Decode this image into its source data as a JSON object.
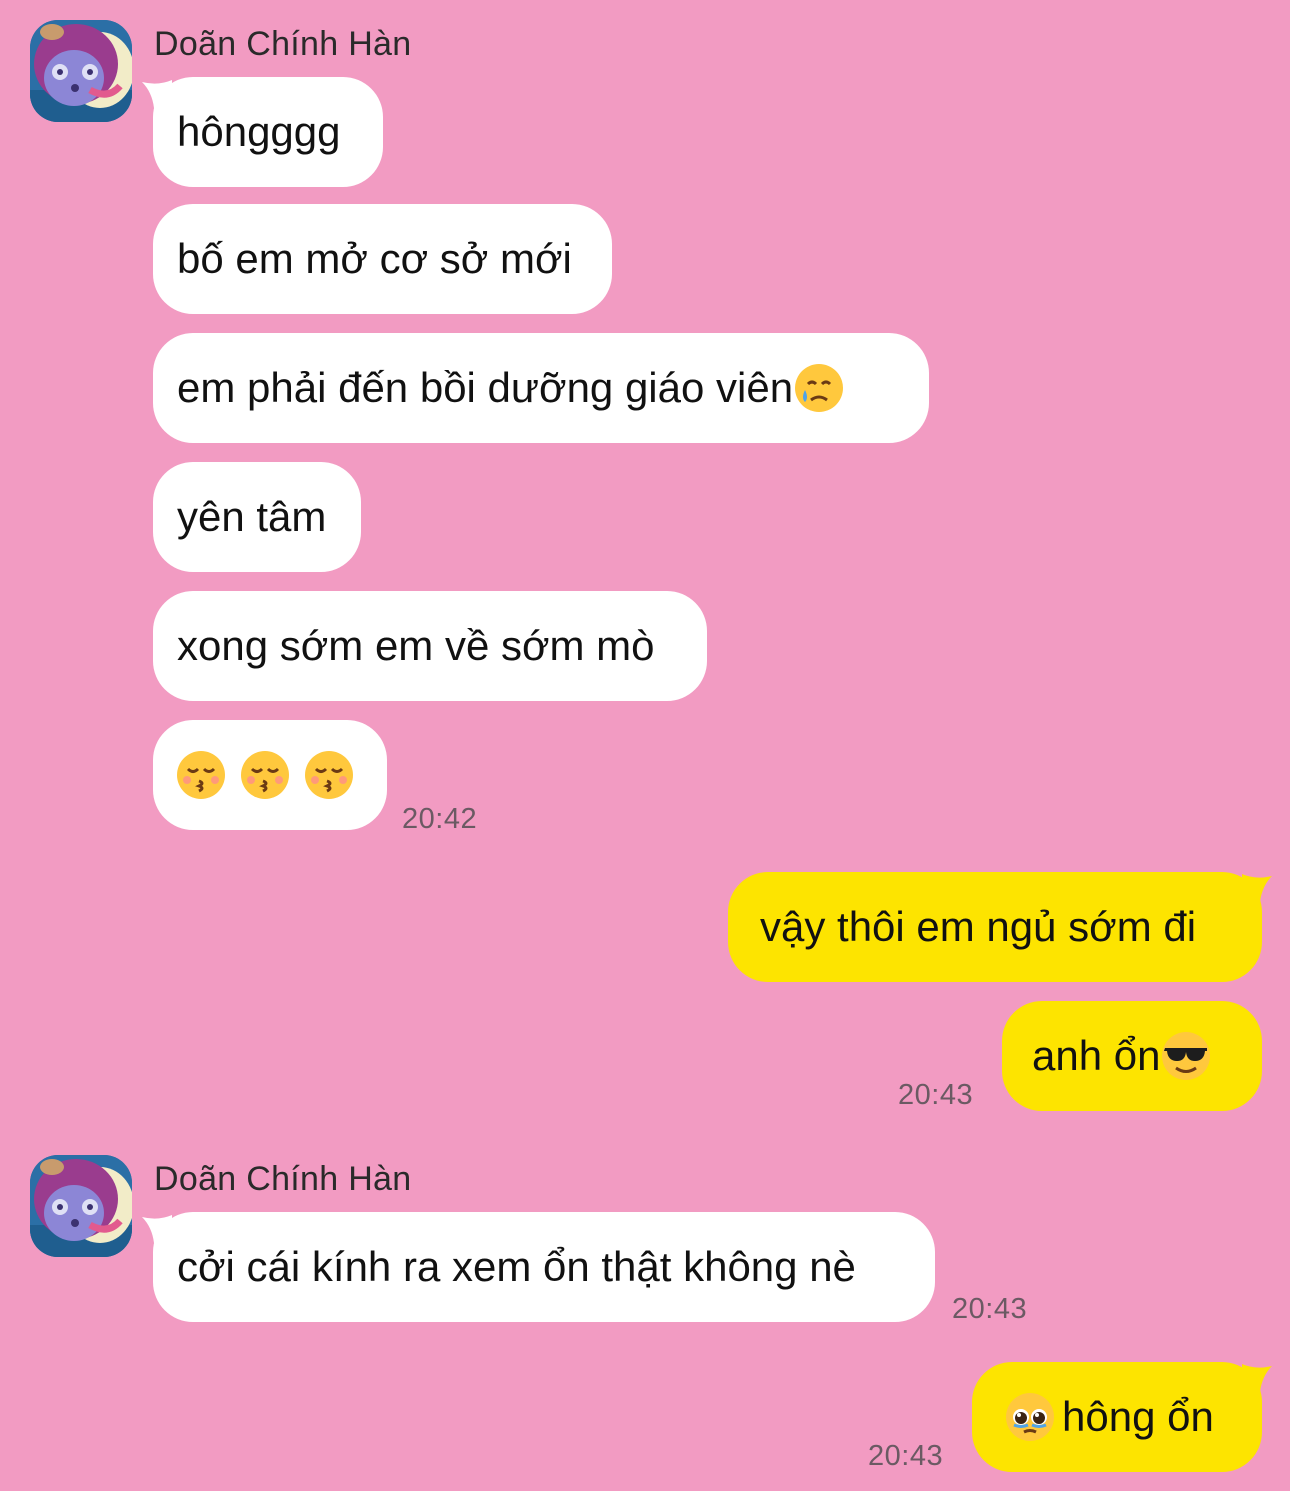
{
  "conversation": [
    {
      "sender": "Doãn Chính Hàn",
      "messages": [
        "hôngggg",
        "bố em mở cơ sở mới",
        "em phải đến bồi dưỡng giáo viên",
        "yên tâm",
        "xong sớm em về sớm mò"
      ],
      "emoji_message": [
        "kissing-face-closed-eyes",
        "kissing-face-closed-eyes",
        "kissing-face-closed-eyes"
      ],
      "time": "20:42"
    }
  ],
  "outgoing_1": {
    "messages": [
      "vậy thôi em ngủ sớm đi",
      "anh ổn"
    ],
    "emoji": "smiling-face-sunglasses",
    "time": "20:43"
  },
  "incoming_2": {
    "sender": "Doãn Chính Hàn",
    "message": "cởi cái kính ra xem ổn thật không nè",
    "time": "20:43"
  },
  "outgoing_2": {
    "emoji": "pleading-face",
    "message": "hông ổn",
    "time": "20:43"
  },
  "colors": {
    "background": "#f29bc2",
    "incoming_bubble": "#ffffff",
    "outgoing_bubble": "#fde400"
  }
}
